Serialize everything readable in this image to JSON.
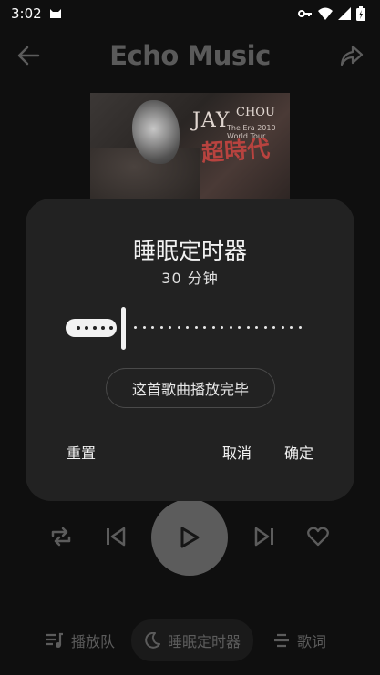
{
  "status_bar": {
    "time": "3:02"
  },
  "header": {
    "title": "Echo Music"
  },
  "album_art": {
    "artist_text": "JAY",
    "artist_text_2": "CHOU",
    "year_text": "The Era 2010 World Tour",
    "chinese_title": "超時代"
  },
  "sleep_timer_dialog": {
    "title": "睡眠定时器",
    "duration_label": "30 分钟",
    "duration_minutes": 30,
    "end_of_song_chip": "这首歌曲播放完毕",
    "reset_label": "重置",
    "cancel_label": "取消",
    "confirm_label": "确定"
  },
  "bottom_nav": {
    "queue_label": "播放队",
    "sleep_timer_label": "睡眠定时器",
    "lyrics_label": "歌词"
  },
  "colors": {
    "background": "#0f0f0f",
    "dialog_bg": "#222222",
    "play_button": "#5c5c5c",
    "muted": "#5c5c5c"
  },
  "icons": [
    "arrow-back-icon",
    "share-icon",
    "repeat-icon",
    "skip-previous-icon",
    "play-icon",
    "skip-next-icon",
    "heart-icon",
    "queue-icon",
    "moon-icon",
    "lyrics-icon",
    "key-icon",
    "wifi-icon",
    "signal-icon",
    "battery-icon",
    "cat-icon"
  ]
}
